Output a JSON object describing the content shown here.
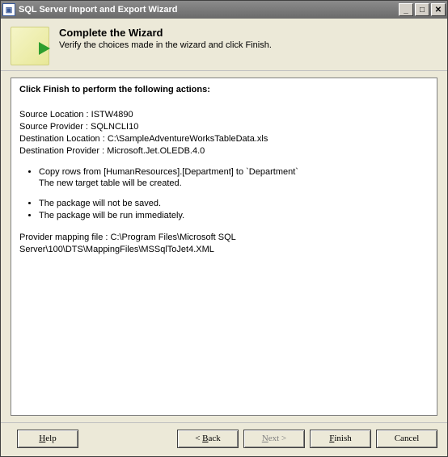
{
  "window": {
    "title": "SQL Server Import and Export Wizard"
  },
  "header": {
    "title": "Complete the Wizard",
    "subtitle": "Verify the choices made in the wizard and click Finish."
  },
  "content": {
    "heading": "Click Finish to perform the following actions:",
    "lines": {
      "source_location": "Source Location : ISTW4890",
      "source_provider": "Source Provider : SQLNCLI10",
      "dest_location": "Destination Location : C:\\SampleAdventureWorksTableData.xls",
      "dest_provider": "Destination Provider : Microsoft.Jet.OLEDB.4.0"
    },
    "bullets_a": [
      "Copy rows from [HumanResources].[Department] to `Department`",
      "The new target table will be created."
    ],
    "bullets_b": [
      "The package will not be saved.",
      "The package will be run immediately."
    ],
    "mapping": "Provider mapping file : C:\\Program Files\\Microsoft SQL Server\\100\\DTS\\MappingFiles\\MSSqlToJet4.XML"
  },
  "footer": {
    "help": "Help",
    "back_prefix": "< ",
    "back": "Back",
    "next": "Next",
    "next_suffix": " >",
    "finish": "Finish",
    "cancel": "Cancel"
  }
}
